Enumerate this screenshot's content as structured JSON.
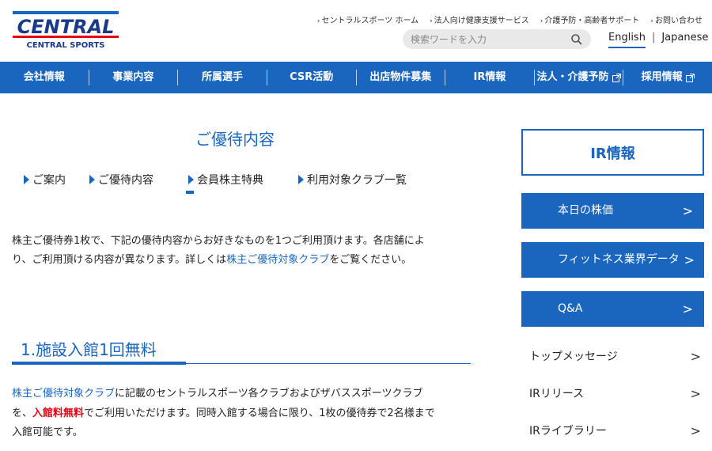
{
  "header": {
    "logo_text": "CENTRAL SPORTS",
    "utility_links": [
      "セントラルスポーツ ホーム",
      "法人向け健康支援サービス",
      "介護予防・高齢者サポート",
      "お問い合わせ"
    ],
    "search_placeholder": "検索ワードを入力",
    "lang_english": "English",
    "lang_sep": "|",
    "lang_japanese": "Japanese"
  },
  "nav": {
    "items": [
      "会社情報",
      "事業内容",
      "所属選手",
      "CSR活動",
      "出店物件募集",
      "IR情報",
      "法人・介護予防",
      "採用情報"
    ]
  },
  "main": {
    "page_title": "ご優待内容",
    "subnav": [
      "ご案内",
      "ご優待内容",
      "会員株主特典",
      "利用対象クラブ一覧"
    ],
    "intro_1": "株主ご優待券1枚で、下記の優待内容からお好きなものを1つご利用頂けます。各店舗によ",
    "intro_2": "り、ご利用頂ける内容が異なります。詳しくは",
    "intro_link": "株主ご優待対象クラブ",
    "intro_3": "をご覧ください。",
    "section_title": "1.施設入館1回無料",
    "body_link": "株主ご優待対象クラブ",
    "body_1": "に記載のセントラルスポーツ各クラブおよびザバススポーツクラブ",
    "body_2a": "を、",
    "body_red": "入館料無料",
    "body_2b": "でご利用いただけます。同時入館する場合に限り、1枚の優待券で2名様まで",
    "body_3": "入館可能です。"
  },
  "sidebar": {
    "ir_title": "IR情報",
    "buttons": [
      "本日の株価",
      "フィットネス業界データ",
      "Q&A"
    ],
    "links": [
      "トップメッセージ",
      "IRリリース",
      "IRライブラリー"
    ],
    "chevron": ">"
  },
  "colors": {
    "brand_blue": "#1a66bf",
    "red": "#e60012"
  }
}
